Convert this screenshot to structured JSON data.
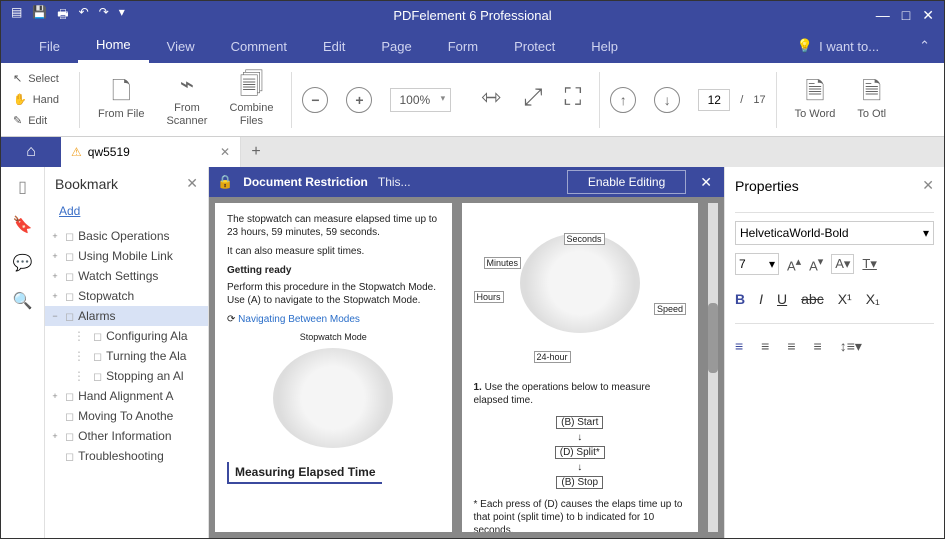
{
  "app": {
    "title": "PDFelement 6 Professional"
  },
  "menu": {
    "file": "File",
    "home": "Home",
    "view": "View",
    "comment": "Comment",
    "edit": "Edit",
    "page": "Page",
    "form": "Form",
    "protect": "Protect",
    "help": "Help",
    "iwant": "I want to..."
  },
  "tools": {
    "select": "Select",
    "hand": "Hand",
    "edit": "Edit"
  },
  "ribbon": {
    "from_file": "From File",
    "from_scanner": "From\nScanner",
    "combine": "Combine\nFiles",
    "zoom": "100%",
    "page_current": "12",
    "page_sep": "/",
    "page_total": "17",
    "to_word": "To Word",
    "to_other": "To Otl"
  },
  "tab": {
    "name": "qw5519"
  },
  "restriction": {
    "title": "Document Restriction",
    "msg": "This...",
    "enable": "Enable Editing"
  },
  "bookmarks": {
    "title": "Bookmark",
    "add": "Add",
    "items": [
      {
        "label": "Basic Operations",
        "exp": "+"
      },
      {
        "label": "Using Mobile Link",
        "exp": "+"
      },
      {
        "label": "Watch Settings",
        "exp": "+"
      },
      {
        "label": "Stopwatch",
        "exp": "+"
      },
      {
        "label": "Alarms",
        "exp": "−",
        "selected": true
      },
      {
        "label": "Configuring Ala",
        "child": true
      },
      {
        "label": "Turning the Ala",
        "child": true
      },
      {
        "label": "Stopping an Al",
        "child": true
      },
      {
        "label": "Hand Alignment A",
        "exp": "+"
      },
      {
        "label": "Moving To Anothe"
      },
      {
        "label": "Other Information",
        "exp": "+"
      },
      {
        "label": "Troubleshooting"
      }
    ]
  },
  "doc": {
    "p1": "The stopwatch can measure elapsed time up to 23 hours, 59 minutes, 59 seconds.",
    "p2": "It can also measure split times.",
    "h1": "Getting ready",
    "p3": "Perform this procedure in the Stopwatch Mode. Use (A) to navigate to the Stopwatch Mode.",
    "link1": "Navigating Between Modes",
    "cap1": "Stopwatch Mode",
    "sect1": "Measuring Elapsed Time",
    "labels": {
      "seconds": "Seconds",
      "minutes": "Minutes",
      "hours": "Hours",
      "speed": "Speed",
      "h24": "24-hour"
    },
    "step1_n": "1.",
    "step1": "Use the operations below to measure elapsed time.",
    "b_start": "Start",
    "d_split": "Split*",
    "b_stop": "Stop",
    "note": "* Each press of (D) causes the elaps time up to that point (split time) to b indicated for 10 seconds."
  },
  "props": {
    "title": "Properties",
    "font": "HelveticaWorld-Bold",
    "size": "7",
    "sup": "X¹",
    "sub": "X₁"
  }
}
